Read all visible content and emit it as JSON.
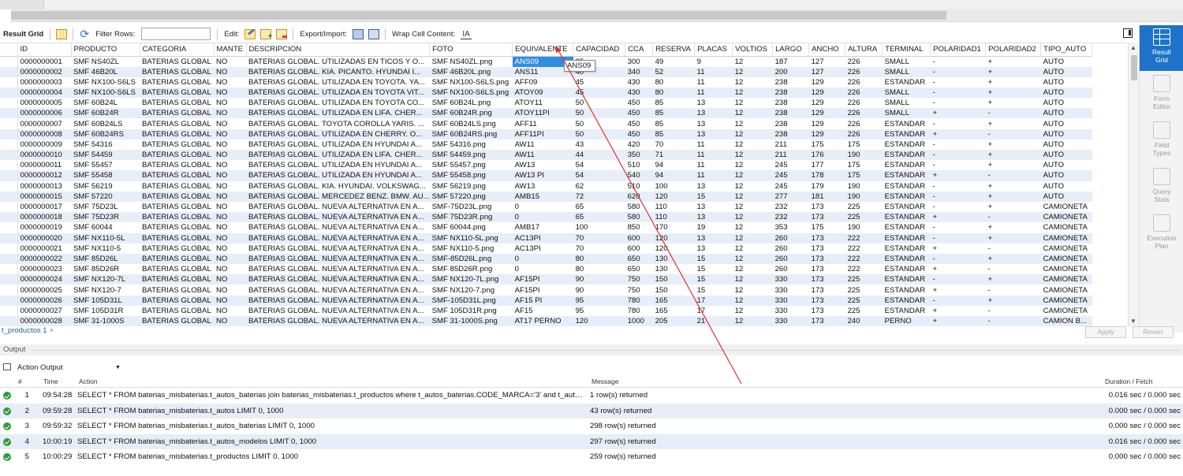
{
  "toolbar": {
    "result_grid_label": "Result Grid",
    "filter_rows_label": "Filter Rows:",
    "filter_value": "",
    "edit_label": "Edit:",
    "export_import_label": "Export/Import:",
    "wrap_cell_label": "Wrap Cell Content:"
  },
  "grid": {
    "columns": [
      "ID",
      "PRODUCTO",
      "CATEGORIA",
      "MANTE",
      "DESCRIPCION",
      "FOTO",
      "EQUIVALENTE",
      "CAPACIDAD",
      "CCA",
      "RESERVA",
      "PLACAS",
      "VOLTIOS",
      "LARGO",
      "ANCHO",
      "ALTURA",
      "TERMINAL",
      "POLARIDAD1",
      "POLARIDAD2",
      "TIPO_AUTO"
    ],
    "rows": [
      [
        "0000000001",
        "SMF NS40ZL",
        "BATERIAS GLOBAL",
        "NO",
        "BATERIAS GLOBAL. UTILIZADAS EN TICOS Y O...",
        "SMF NS40ZL.png",
        "ANS09",
        "35",
        "300",
        "49",
        "9",
        "12",
        "187",
        "127",
        "226",
        "SMALL",
        "-",
        "+",
        "AUTO"
      ],
      [
        "0000000002",
        "SMF 46B20L",
        "BATERIAS GLOBAL",
        "NO",
        "BATERIAS GLOBAL. KIA. PICANTO. HYUNDAI I...",
        "SMF 46B20L.png",
        "ANS11",
        "40",
        "340",
        "52",
        "11",
        "12",
        "200",
        "127",
        "226",
        "SMALL",
        "-",
        "+",
        "AUTO"
      ],
      [
        "0000000003",
        "SMF NX100-S6LS",
        "BATERIAS GLOBAL",
        "NO",
        "BATERIAS GLOBAL. UTILIZADA EN TOYOTA. YA...",
        "SMF NX100-S6LS.png",
        "AFF09",
        "45",
        "430",
        "80",
        "11",
        "12",
        "238",
        "129",
        "226",
        "ESTANDAR",
        "-",
        "+",
        "AUTO"
      ],
      [
        "0000000004",
        "SMF NX100-S6LS",
        "BATERIAS GLOBAL",
        "NO",
        "BATERIAS GLOBAL. UTILIZADA EN TOYOTA VIT...",
        "SMF NX100-S6LS.png",
        "ATOY09",
        "45",
        "430",
        "80",
        "11",
        "12",
        "238",
        "129",
        "226",
        "SMALL",
        "-",
        "+",
        "AUTO"
      ],
      [
        "0000000005",
        "SMF 60B24L",
        "BATERIAS GLOBAL",
        "NO",
        "BATERIAS GLOBAL. UTILIZADA EN TOYOTA CO...",
        "SMF 60B24L.png",
        "ATOY11",
        "50",
        "450",
        "85",
        "13",
        "12",
        "238",
        "129",
        "226",
        "SMALL",
        "-",
        "+",
        "AUTO"
      ],
      [
        "0000000006",
        "SMF 60B24R",
        "BATERIAS GLOBAL",
        "NO",
        "BATERIAS GLOBAL. UTILIZADA EN LIFA. CHER...",
        "SMF 60B24R.png",
        "ATOY11PI",
        "50",
        "450",
        "85",
        "13",
        "12",
        "238",
        "129",
        "226",
        "SMALL",
        "+",
        "-",
        "AUTO"
      ],
      [
        "0000000007",
        "SMF 60B24LS",
        "BATERIAS GLOBAL",
        "NO",
        "BATERIAS GLOBAL. TOYOTA COROLLA YARIS. ...",
        "SMF 60B24LS.png",
        "AFF11",
        "50",
        "450",
        "85",
        "13",
        "12",
        "238",
        "129",
        "226",
        "ESTANDAR",
        "-",
        "+",
        "AUTO"
      ],
      [
        "0000000008",
        "SMF 60B24RS",
        "BATERIAS GLOBAL",
        "NO",
        "BATERIAS GLOBAL. UTILIZADA EN CHERRY. O...",
        "SMF 60B24RS.png",
        "AFF11PI",
        "50",
        "450",
        "85",
        "13",
        "12",
        "238",
        "129",
        "226",
        "ESTANDAR",
        "+",
        "-",
        "AUTO"
      ],
      [
        "0000000009",
        "SMF 54316",
        "BATERIAS GLOBAL",
        "NO",
        "BATERIAS GLOBAL. UTILIZADA EN HYUNDAI A...",
        "SMF 54316.png",
        "AW11",
        "43",
        "420",
        "70",
        "11",
        "12",
        "211",
        "175",
        "175",
        "ESTANDAR",
        "-",
        "+",
        "AUTO"
      ],
      [
        "0000000010",
        "SMF 54459",
        "BATERIAS GLOBAL",
        "NO",
        "BATERIAS GLOBAL. UTILIZADA EN LIFA. CHER...",
        "SMF 54459.png",
        "AW11",
        "44",
        "350",
        "71",
        "11",
        "12",
        "211",
        "176",
        "190",
        "ESTANDAR",
        "-",
        "+",
        "AUTO"
      ],
      [
        "0000000011",
        "SMF 55457",
        "BATERIAS GLOBAL",
        "NO",
        "BATERIAS GLOBAL. UTILIZADA EN HYUNDAI A...",
        "SMF 55457.png",
        "AW13",
        "54",
        "510",
        "94",
        "11",
        "12",
        "245",
        "177",
        "175",
        "ESTANDAR",
        "-",
        "+",
        "AUTO"
      ],
      [
        "0000000012",
        "SMF 55458",
        "BATERIAS GLOBAL",
        "NO",
        "BATERIAS GLOBAL. UTILIZADA EN HYUNDAI A...",
        "SMF 55458.png",
        "AW13 PI",
        "54",
        "540",
        "94",
        "11",
        "12",
        "245",
        "178",
        "175",
        "ESTANDAR",
        "+",
        "-",
        "AUTO"
      ],
      [
        "0000000013",
        "SMF 56219",
        "BATERIAS GLOBAL",
        "NO",
        "BATERIAS GLOBAL. KIA. HYUNDAI. VOLKSWAG...",
        "SMF 56219.png",
        "AW13",
        "62",
        "510",
        "100",
        "13",
        "12",
        "245",
        "179",
        "190",
        "ESTANDAR",
        "-",
        "+",
        "AUTO"
      ],
      [
        "0000000015",
        "SMF 57220",
        "BATERIAS GLOBAL",
        "NO",
        "BATERIAS GLOBAL. MERCEDEZ BENZ. BMW. AU...",
        "SMF 57220.png",
        "AMB15",
        "72",
        "620",
        "120",
        "15",
        "12",
        "277",
        "181",
        "190",
        "ESTANDAR",
        "-",
        "+",
        "AUTO"
      ],
      [
        "0000000017",
        "SMF 75D23L",
        "BATERIAS GLOBAL",
        "NO",
        "BATERIAS GLOBAL. NUEVA ALTERNATIVA EN A...",
        "SMF-75D23L.png",
        "0",
        "65",
        "580",
        "110",
        "13",
        "12",
        "232",
        "173",
        "225",
        "ESTANDAR",
        "-",
        "+",
        "CAMIONETA"
      ],
      [
        "0000000018",
        "SMF 75D23R",
        "BATERIAS GLOBAL",
        "NO",
        "BATERIAS GLOBAL. NUEVA ALTERNATIVA EN A...",
        "SMF 75D23R.png",
        "0",
        "65",
        "580",
        "110",
        "13",
        "12",
        "232",
        "173",
        "225",
        "ESTANDAR",
        "+",
        "-",
        "CAMIONETA"
      ],
      [
        "0000000019",
        "SMF 60044",
        "BATERIAS GLOBAL",
        "NO",
        "BATERIAS GLOBAL. NUEVA ALTERNATIVA EN A...",
        "SMF 60044.png",
        "AMB17",
        "100",
        "850",
        "170",
        "19",
        "12",
        "353",
        "175",
        "190",
        "ESTANDAR",
        "-",
        "+",
        "CAMIONETA"
      ],
      [
        "0000000020",
        "SMF NX110-5L",
        "BATERIAS GLOBAL",
        "NO",
        "BATERIAS GLOBAL. NUEVA ALTERNATIVA EN A...",
        "SMF NX110-5L.png",
        "AC13PI",
        "70",
        "600",
        "120",
        "13",
        "12",
        "260",
        "173",
        "222",
        "ESTANDAR",
        "-",
        "+",
        "CAMIONETA"
      ],
      [
        "0000000021",
        "SMF NX110-5",
        "BATERIAS GLOBAL",
        "NO",
        "BATERIAS GLOBAL. NUEVA ALTERNATIVA EN A...",
        "SMF NX110-5.png",
        "AC13PI",
        "70",
        "600",
        "120",
        "13",
        "12",
        "260",
        "173",
        "222",
        "ESTANDAR",
        "+",
        "-",
        "CAMIONETA"
      ],
      [
        "0000000022",
        "SMF 85D26L",
        "BATERIAS GLOBAL",
        "NO",
        "BATERIAS GLOBAL. NUEVA ALTERNATIVA EN A...",
        "SMF-85D26L.png",
        "0",
        "80",
        "650",
        "130",
        "15",
        "12",
        "260",
        "173",
        "222",
        "ESTANDAR",
        "-",
        "+",
        "CAMIONETA"
      ],
      [
        "0000000023",
        "SMF 85D26R",
        "BATERIAS GLOBAL",
        "NO",
        "BATERIAS GLOBAL. NUEVA ALTERNATIVA EN A...",
        "SMF 85D26R.png",
        "0",
        "80",
        "650",
        "130",
        "15",
        "12",
        "260",
        "173",
        "222",
        "ESTANDAR",
        "+",
        "-",
        "CAMIONETA"
      ],
      [
        "0000000024",
        "SMF NX120-7L",
        "BATERIAS GLOBAL",
        "NO",
        "BATERIAS GLOBAL. NUEVA ALTERNATIVA EN A...",
        "SMF NX120-7L.png",
        "AF15PI",
        "90",
        "750",
        "150",
        "15",
        "12",
        "330",
        "173",
        "225",
        "ESTANDAR",
        "-",
        "+",
        "CAMIONETA"
      ],
      [
        "0000000025",
        "SMF NX120-7",
        "BATERIAS GLOBAL",
        "NO",
        "BATERIAS GLOBAL. NUEVA ALTERNATIVA EN A...",
        "SMF NX120-7.png",
        "AF15PI",
        "90",
        "750",
        "150",
        "15",
        "12",
        "330",
        "173",
        "225",
        "ESTANDAR",
        "+",
        "-",
        "CAMIONETA"
      ],
      [
        "0000000026",
        "SMF 105D31L",
        "BATERIAS GLOBAL",
        "NO",
        "BATERIAS GLOBAL. NUEVA ALTERNATIVA EN A...",
        "SMF-105D31L.png",
        "AF15 PI",
        "95",
        "780",
        "165",
        "17",
        "12",
        "330",
        "173",
        "225",
        "ESTANDAR",
        "-",
        "+",
        "CAMIONETA"
      ],
      [
        "0000000027",
        "SMF 105D31R",
        "BATERIAS GLOBAL",
        "NO",
        "BATERIAS GLOBAL. NUEVA ALTERNATIVA EN A...",
        "SMF 105D31R.png",
        "AF15",
        "95",
        "780",
        "165",
        "17",
        "12",
        "330",
        "173",
        "225",
        "ESTANDAR",
        "+",
        "-",
        "CAMIONETA"
      ],
      [
        "0000000028",
        "SMF 31-1000S",
        "BATERIAS GLOBAL",
        "NO",
        "BATERIAS GLOBAL. NUEVA ALTERNATIVA EN A...",
        "SMF 31-1000S.png",
        "AT17 PERNO",
        "120",
        "1000",
        "205",
        "21",
        "12",
        "330",
        "173",
        "240",
        "PERNO",
        "+",
        "-",
        "CAMION B..."
      ]
    ],
    "tooltip": "ANS09"
  },
  "side_panel": [
    {
      "label": "Result Grid",
      "icon": "result-grid-icon",
      "active": true
    },
    {
      "label": "Form Editor",
      "icon": "form-editor-icon",
      "active": false
    },
    {
      "label": "Field Types",
      "icon": "field-types-icon",
      "active": false
    },
    {
      "label": "Query Stats",
      "icon": "query-stats-icon",
      "active": false
    },
    {
      "label": "Execution Plan",
      "icon": "execution-plan-icon",
      "active": false
    }
  ],
  "result_tab": {
    "label": "t_productos 1",
    "close": "×"
  },
  "buttons": {
    "apply": "Apply",
    "revert": "Revert"
  },
  "output": {
    "title": "Output",
    "selector": "Action Output",
    "headers": {
      "num": "#",
      "time": "Time",
      "action": "Action",
      "message": "Message",
      "duration": "Duration / Fetch"
    },
    "rows": [
      {
        "num": "1",
        "time": "09:54:28",
        "action": "SELECT * FROM baterias_misbaterias.t_autos_baterias join baterias_misbaterias.t_productos where t_autos_baterias.CODE_MARCA='3' and t_autos_bat...",
        "message": "1 row(s) returned",
        "duration": "0.016 sec / 0.000 sec"
      },
      {
        "num": "2",
        "time": "09:59:28",
        "action": "SELECT * FROM baterias_misbaterias.t_autos LIMIT 0, 1000",
        "message": "43 row(s) returned",
        "duration": "0.000 sec / 0.000 sec"
      },
      {
        "num": "3",
        "time": "09:59:32",
        "action": "SELECT * FROM baterias_misbaterias.t_autos_baterias LIMIT 0, 1000",
        "message": "298 row(s) returned",
        "duration": "0.000 sec / 0.000 sec"
      },
      {
        "num": "4",
        "time": "10:00:19",
        "action": "SELECT * FROM baterias_misbaterias.t_autos_modelos LIMIT 0, 1000",
        "message": "297 row(s) returned",
        "duration": "0.016 sec / 0.000 sec"
      },
      {
        "num": "5",
        "time": "10:00:29",
        "action": "SELECT * FROM baterias_misbaterias.t_productos LIMIT 0, 1000",
        "message": "259 row(s) returned",
        "duration": "0.000 sec / 0.000 sec"
      }
    ]
  },
  "colors": {
    "accent": "#1e73c8",
    "selection": "#2f8ee0",
    "row_alt": "#e7eef8",
    "annotation": "#e03030",
    "success": "#2f9a3a"
  }
}
